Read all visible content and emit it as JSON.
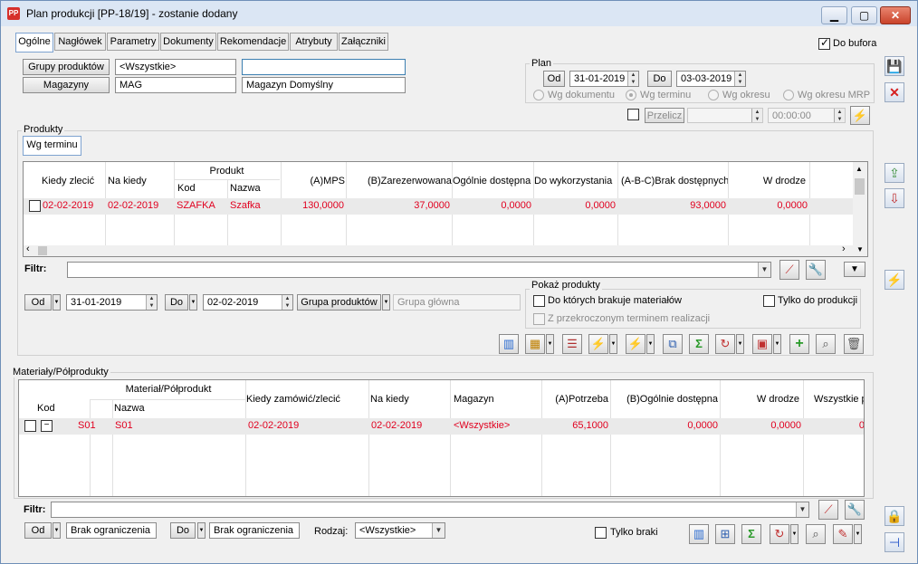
{
  "window": {
    "title": "Plan produkcji [PP-18/19] - zostanie dodany",
    "app_icon_text": "PP"
  },
  "tabs": [
    "Ogólne",
    "Nagłówek",
    "Parametry",
    "Dokumenty",
    "Rekomendacje",
    "Atrybuty",
    "Załączniki"
  ],
  "do_bufora": {
    "label": "Do bufora",
    "checked": true
  },
  "header": {
    "grupy_btn": "Grupy produktów",
    "grupy_value": "<Wszystkie>",
    "grupy_extra": "",
    "magazyny_btn": "Magazyny",
    "magazyn_code": "MAG",
    "magazyn_name": "Magazyn Domyślny"
  },
  "plan": {
    "label": "Plan",
    "od_label": "Od",
    "od_value": "31-01-2019",
    "do_label": "Do",
    "do_value": "03-03-2019",
    "radios": [
      "Wg dokumentu",
      "Wg terminu",
      "Wg okresu",
      "Wg okresu MRP"
    ],
    "selected_radio": "Wg terminu",
    "przelicz_label": "Przelicz",
    "time_value": "00:00:00"
  },
  "produkty": {
    "label": "Produkty",
    "subtab": "Wg terminu",
    "columns": {
      "kiedy_zlecic": "Kiedy zlecić",
      "na_kiedy": "Na kiedy",
      "produkt": "Produkt",
      "kod": "Kod",
      "nazwa": "Nazwa",
      "mps": "(A)MPS",
      "zarezerwowana": "(B)Zarezerwowana",
      "ogolnie_dostepna": "Ogólnie dostępna",
      "do_wykorzystania": "Do wykorzystania",
      "brak_dostepnych": "(A-B-C)Brak dostępnych",
      "w_drodze": "W drodze"
    },
    "rows": [
      {
        "kiedy_zlecic": "02-02-2019",
        "na_kiedy": "02-02-2019",
        "kod": "SZAFKA",
        "nazwa": "Szafka",
        "mps": "130,0000",
        "zarezerwowana": "37,0000",
        "ogolnie_dostepna": "0,0000",
        "do_wykorzystania": "0,0000",
        "brak_dostepnych": "93,0000",
        "w_drodze": "0,0000"
      }
    ],
    "filtr_label": "Filtr:",
    "od_label": "Od",
    "od_value": "31-01-2019",
    "do_label": "Do",
    "do_value": "02-02-2019",
    "grupa_btn": "Grupa produktów",
    "grupa_value": "Grupa główna",
    "pokaz": {
      "label": "Pokaż produkty",
      "braki": "Do których brakuje materiałów",
      "tylko_prod": "Tylko do produkcji",
      "przekroczony": "Z przekroczonym terminem realizacji"
    }
  },
  "materialy": {
    "label": "Materiały/Półprodukty",
    "columns": {
      "material": "Materiał/Półprodukt",
      "kod": "Kod",
      "nazwa": "Nazwa",
      "kiedy_zamowic": "Kiedy zamówić/zlecić",
      "na_kiedy": "Na kiedy",
      "magazyn": "Magazyn",
      "potrzeba": "(A)Potrzeba",
      "ogolnie_dostepna": "(B)Ogólnie dostępna",
      "w_drodze": "W drodze",
      "wszystkie": "Wszystkie p"
    },
    "rows": [
      {
        "kod": "S01",
        "nazwa": "S01",
        "kiedy": "02-02-2019",
        "na_kiedy": "02-02-2019",
        "magazyn": "<Wszystkie>",
        "potrzeba": "65,1000",
        "ogolnie": "0,0000",
        "w_drodze": "0,0000",
        "wszystkie": "0"
      }
    ],
    "filtr_label": "Filtr:",
    "od_label": "Od",
    "od_value": "Brak ograniczenia",
    "do_label": "Do",
    "do_value": "Brak ograniczenia",
    "rodzaj_label": "Rodzaj:",
    "rodzaj_value": "<Wszystkie>",
    "tylko_braki": "Tylko braki"
  },
  "colors": {
    "accent": "#e1001f",
    "selection": "#3c7fb1"
  }
}
